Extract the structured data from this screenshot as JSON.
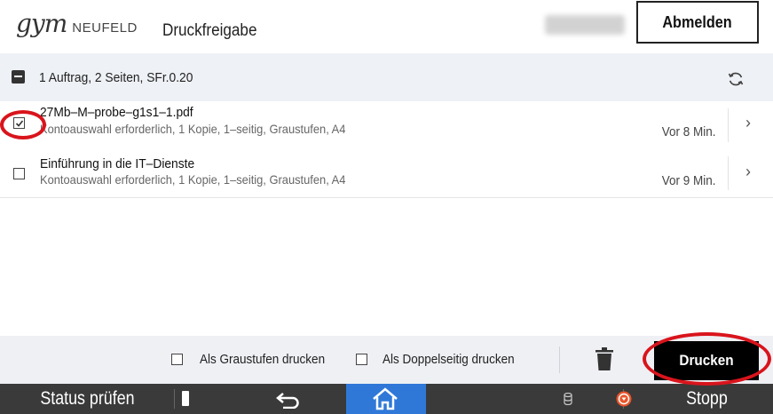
{
  "header": {
    "logo_primary": "gym",
    "logo_secondary": "NEUFELD",
    "title": "Druckfreigabe",
    "logout_label": "Abmelden"
  },
  "summary": {
    "text": "1 Auftrag, 2 Seiten, SFr.0.20"
  },
  "jobs": [
    {
      "name": "27Mb–M–probe–g1s1–1.pdf",
      "details": "Kontoauswahl erforderlich, 1 Kopie, 1–seitig, Graustufen, A4",
      "time": "Vor 8 Min.",
      "selected": true
    },
    {
      "name": "Einführung in die IT–Dienste",
      "details": "Kontoauswahl erforderlich, 1 Kopie, 1–seitig, Graustufen, A4",
      "time": "Vor 9 Min.",
      "selected": false
    }
  ],
  "options": {
    "grayscale_label": "Als Graustufen drucken",
    "duplex_label": "Als Doppelseitig drucken",
    "print_label": "Drucken"
  },
  "system_bar": {
    "status_label": "Status prüfen",
    "stop_label": "Stopp"
  },
  "icons": {
    "refresh": "refresh-icon",
    "chevron": "chevron-right-icon",
    "trash": "trash-icon",
    "back": "back-icon",
    "home": "home-icon",
    "stop": "stop-icon"
  },
  "colors": {
    "home_active": "#2f78d8",
    "stop_accent": "#e8552a",
    "annotation": "#d9141c"
  }
}
